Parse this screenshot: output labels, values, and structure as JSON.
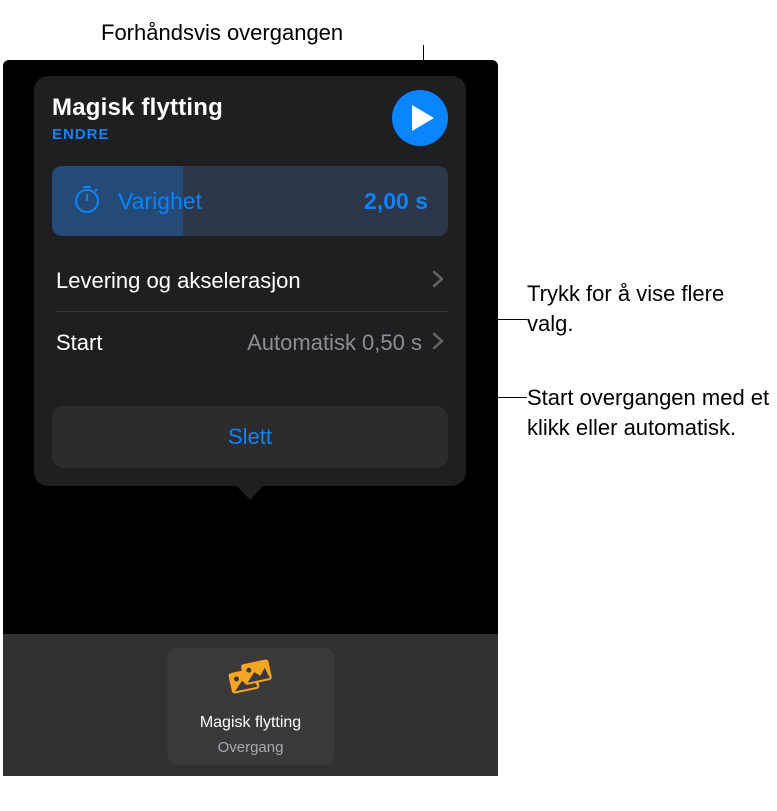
{
  "callouts": {
    "top": "Forhåndsvis overgangen",
    "right1": "Trykk for å vise flere valg.",
    "right2": "Start overgangen med et klikk eller automatisk."
  },
  "popover": {
    "title": "Magisk flytting",
    "subtitle": "ENDRE",
    "duration_label": "Varighet",
    "duration_value": "2,00 s",
    "delivery_label": "Levering og akselerasjon",
    "start_label": "Start",
    "start_value": "Automatisk  0,50 s",
    "delete_label": "Slett"
  },
  "thumb": {
    "title": "Magisk flytting",
    "subtitle": "Overgang"
  }
}
